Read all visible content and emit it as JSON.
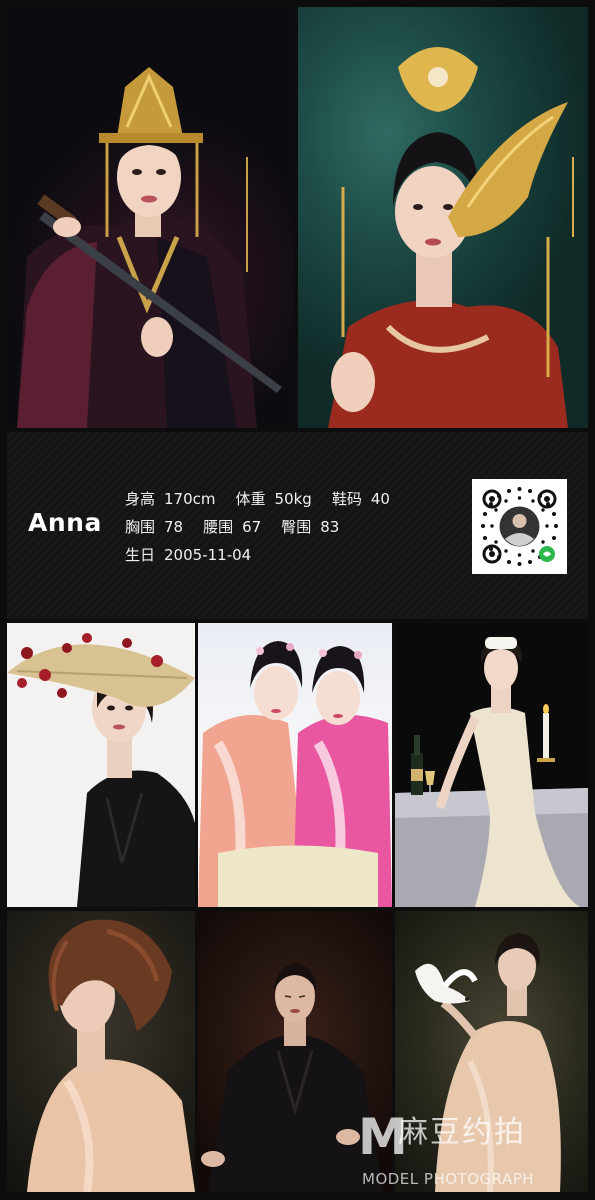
{
  "model": {
    "name": "Anna",
    "height_label": "身高",
    "height_value": "170cm",
    "weight_label": "体重",
    "weight_value": "50kg",
    "shoe_label": "鞋码",
    "shoe_value": "40",
    "bust_label": "胸围",
    "bust_value": "78",
    "waist_label": "腰围",
    "waist_value": "67",
    "hip_label": "臀围",
    "hip_value": "83",
    "birthday_label": "生日",
    "birthday_value": "2005-11-04"
  },
  "watermark": {
    "logo_letter": "M",
    "cn_text": "麻豆约拍",
    "en_text": "MODEL PHOTOGRAPH"
  },
  "photos": [
    "portrait-golden-crown-sword",
    "portrait-phoenix-headdress-red-robe",
    "portrait-straw-hat-black-velvet",
    "portrait-two-women-pink-hanfu",
    "portrait-white-dress-champagne-table",
    "portrait-back-view-peach-blouse",
    "portrait-seated-black-robe",
    "portrait-white-dove-peach-dress"
  ],
  "colors": {
    "background": "#0d0d0d",
    "text": "#ffffff"
  }
}
